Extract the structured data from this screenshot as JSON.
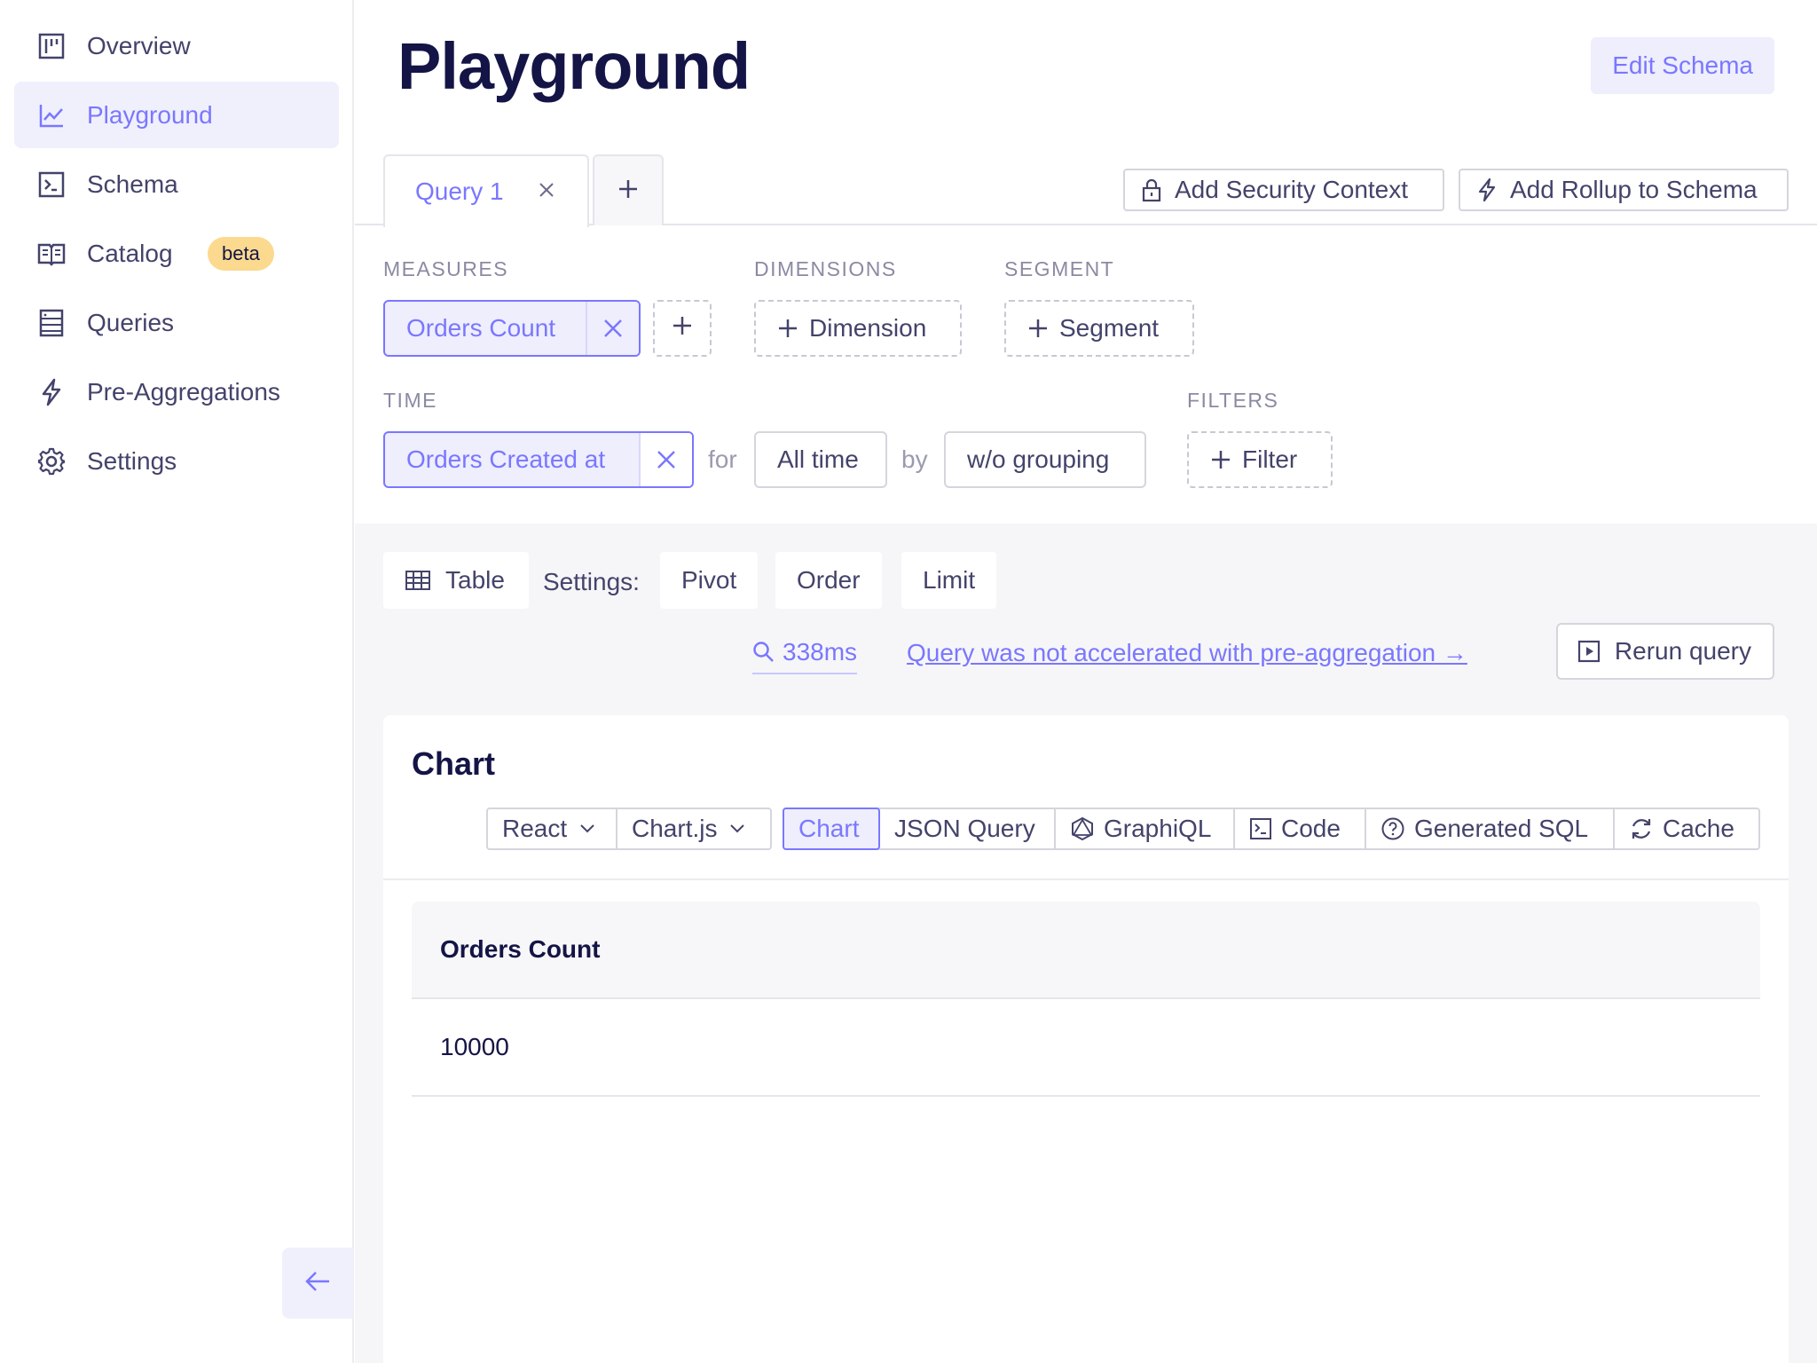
{
  "sidebar": {
    "items": [
      {
        "label": "Overview",
        "icon": "overview-icon"
      },
      {
        "label": "Playground",
        "icon": "chart-line-icon",
        "active": true
      },
      {
        "label": "Schema",
        "icon": "terminal-icon"
      },
      {
        "label": "Catalog",
        "icon": "book-icon",
        "badge": "beta"
      },
      {
        "label": "Queries",
        "icon": "list-icon"
      },
      {
        "label": "Pre-Aggregations",
        "icon": "lightning-icon"
      },
      {
        "label": "Settings",
        "icon": "gear-icon"
      }
    ],
    "collapse_icon": "arrow-left-icon"
  },
  "header": {
    "title": "Playground",
    "edit_schema_label": "Edit Schema"
  },
  "tabs": {
    "query_tab_label": "Query 1",
    "add_security_label": "Add Security Context",
    "add_rollup_label": "Add Rollup to Schema"
  },
  "builder": {
    "measures_label": "MEASURES",
    "dimensions_label": "DIMENSIONS",
    "segment_label": "SEGMENT",
    "time_label": "TIME",
    "filters_label": "FILTERS",
    "measure_value": "Orders Count",
    "dimension_button": "Dimension",
    "segment_button": "Segment",
    "time_value": "Orders Created at",
    "for_label": "for",
    "date_range": "All time",
    "by_label": "by",
    "granularity": "w/o grouping",
    "filter_button": "Filter"
  },
  "toolbar": {
    "table_label": "Table",
    "settings_label": "Settings:",
    "pivot_label": "Pivot",
    "order_label": "Order",
    "limit_label": "Limit",
    "timing": "338ms",
    "accel_link": "Query was not accelerated with pre-aggregation →",
    "rerun_label": "Rerun query"
  },
  "card": {
    "title": "Chart",
    "framework": "React",
    "library": "Chart.js",
    "view_tabs": [
      "Chart",
      "JSON Query",
      "GraphiQL",
      "Code",
      "Generated SQL",
      "Cache"
    ],
    "active_view": "Chart"
  },
  "table": {
    "columns": [
      "Orders Count"
    ],
    "rows": [
      [
        "10000"
      ]
    ]
  },
  "colors": {
    "accent": "#7a77ff",
    "accent_bg": "#eeeefd",
    "text_dark": "#141446",
    "badge_bg": "#fbd98e"
  }
}
